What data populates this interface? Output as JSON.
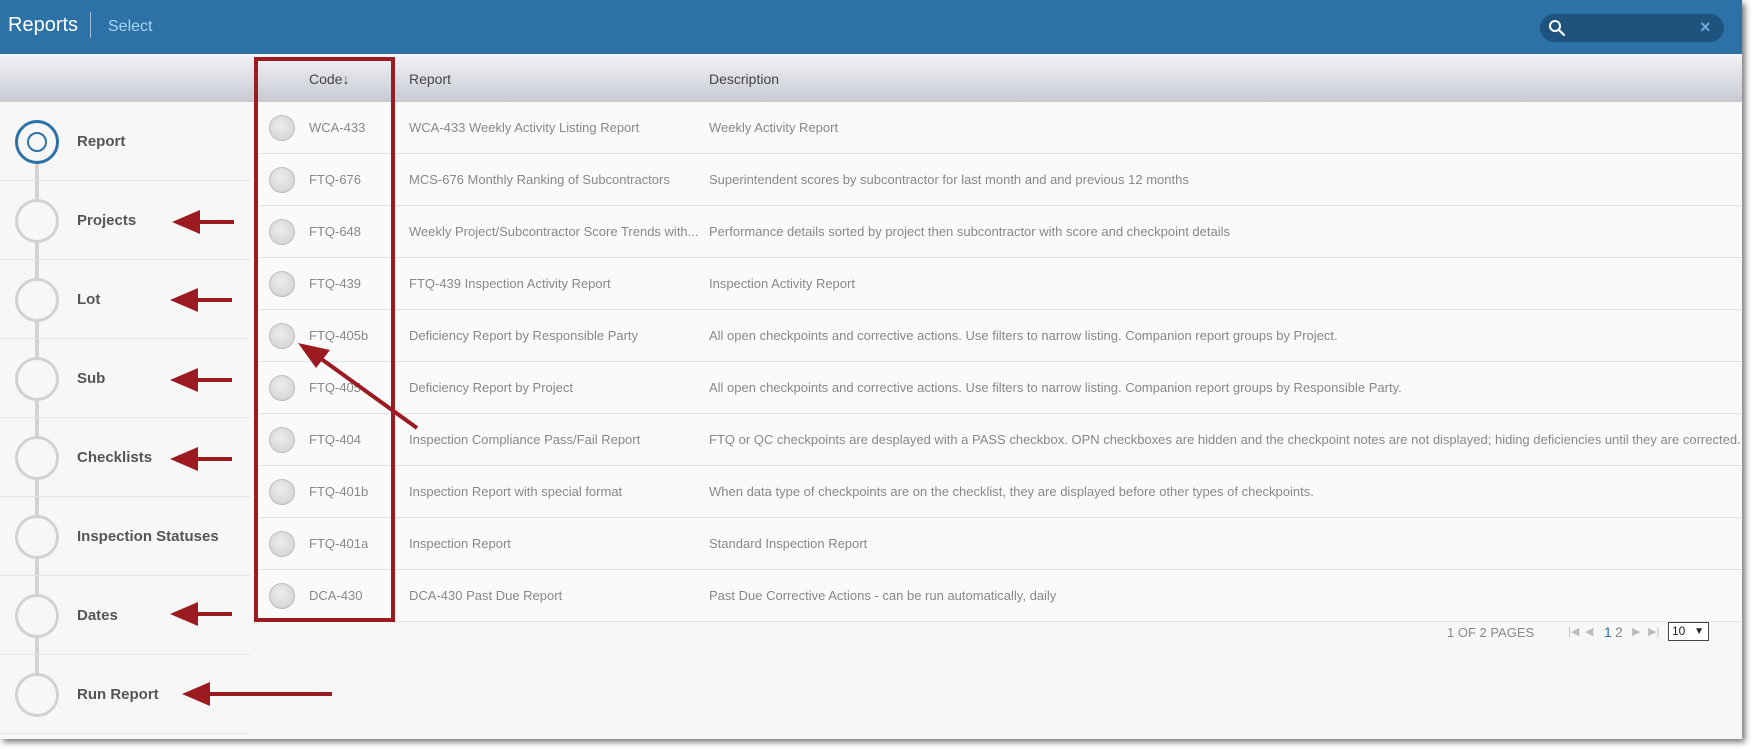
{
  "header": {
    "title": "Reports",
    "select_link": "Select",
    "search_value": "",
    "search_icon": "search-icon",
    "clear_label": "×"
  },
  "steps": [
    {
      "label": "Report",
      "state": "active"
    },
    {
      "label": "Projects"
    },
    {
      "label": "Lot"
    },
    {
      "label": "Sub"
    },
    {
      "label": "Checklists"
    },
    {
      "label": "Inspection Statuses"
    },
    {
      "label": "Dates"
    },
    {
      "label": "Run Report"
    }
  ],
  "table": {
    "headers": {
      "code": "Code↓",
      "report": "Report",
      "description": "Description"
    },
    "rows": [
      {
        "code": "WCA-433",
        "report": "WCA-433 Weekly Activity Listing Report",
        "description": "Weekly Activity Report"
      },
      {
        "code": "FTQ-676",
        "report": "MCS-676 Monthly Ranking of Subcontractors",
        "description": "Superintendent scores by subcontractor for last month and and previous 12 months"
      },
      {
        "code": "FTQ-648",
        "report": "Weekly Project/Subcontractor Score Trends with...",
        "description": "Performance details sorted by project then subcontractor with score and checkpoint details"
      },
      {
        "code": "FTQ-439",
        "report": "FTQ-439 Inspection Activity Report",
        "description": "Inspection Activity Report"
      },
      {
        "code": "FTQ-405b",
        "report": "Deficiency Report by Responsible Party",
        "description": "All open checkpoints and corrective actions. Use filters to narrow listing. Companion report groups by Project."
      },
      {
        "code": "FTQ-405",
        "report": "Deficiency Report by Project",
        "description": "All open checkpoints and corrective actions. Use filters to narrow listing. Companion report groups by Responsible Party."
      },
      {
        "code": "FTQ-404",
        "report": "Inspection Compliance Pass/Fail Report",
        "description": "FTQ or QC checkpoints are desplayed with a PASS checkbox. OPN checkboxes are hidden and the checkpoint notes are not displayed; hiding deficiencies until they are corrected."
      },
      {
        "code": "FTQ-401b",
        "report": "Inspection Report with special format",
        "description": "When data type of checkpoints are on the checklist, they are displayed before other types of checkpoints."
      },
      {
        "code": "FTQ-401a",
        "report": "Inspection Report",
        "description": "Standard Inspection Report"
      },
      {
        "code": "DCA-430",
        "report": "DCA-430 Past Due Report",
        "description": "Past Due Corrective Actions - can be run automatically, daily"
      }
    ]
  },
  "pager": {
    "info": "1 OF 2 PAGES",
    "first": "|◀",
    "prev": "◀",
    "pages": [
      "1",
      "2"
    ],
    "current_page": "1",
    "next": "▶",
    "last": "▶|",
    "page_size": "10",
    "page_size_caret": "▼"
  },
  "colors": {
    "header_bg": "#2d72a6",
    "accent": "#2d72a6",
    "annotation": "#9b1b21",
    "link_current": "#2d72a6"
  }
}
